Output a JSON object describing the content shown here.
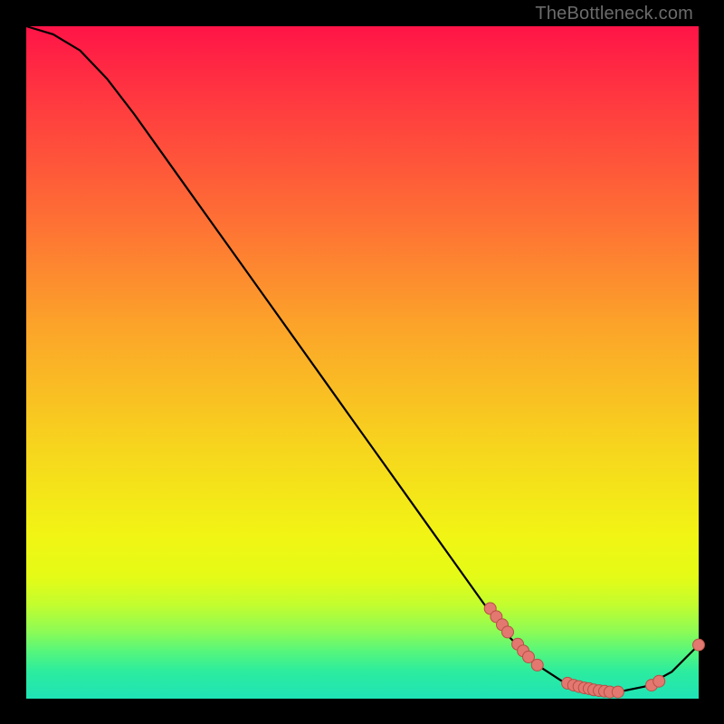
{
  "watermark": "TheBottleneck.com",
  "colors": {
    "line": "#000000",
    "line_width": 2.2,
    "marker_fill": "#e27870",
    "marker_stroke": "#b84f47",
    "marker_radius": 6.5
  },
  "chart_data": {
    "type": "line",
    "title": "",
    "xlabel": "",
    "ylabel": "",
    "xlim": [
      0,
      100
    ],
    "ylim": [
      0,
      100
    ],
    "line_xy": [
      [
        0,
        100
      ],
      [
        4,
        98.8
      ],
      [
        8,
        96.4
      ],
      [
        12,
        92.2
      ],
      [
        16,
        87.0
      ],
      [
        20,
        81.4
      ],
      [
        24,
        75.8
      ],
      [
        28,
        70.2
      ],
      [
        32,
        64.6
      ],
      [
        36,
        59.0
      ],
      [
        40,
        53.4
      ],
      [
        44,
        47.8
      ],
      [
        48,
        42.2
      ],
      [
        52,
        36.6
      ],
      [
        56,
        31.0
      ],
      [
        60,
        25.4
      ],
      [
        64,
        19.8
      ],
      [
        68,
        14.2
      ],
      [
        72,
        9.0
      ],
      [
        76,
        5.0
      ],
      [
        80,
        2.4
      ],
      [
        84,
        1.2
      ],
      [
        88,
        1.0
      ],
      [
        92,
        1.8
      ],
      [
        96,
        4.0
      ],
      [
        100,
        8.0
      ]
    ],
    "markers_xy": [
      [
        69.0,
        13.4
      ],
      [
        69.9,
        12.2
      ],
      [
        70.8,
        11.0
      ],
      [
        71.6,
        9.9
      ],
      [
        73.1,
        8.1
      ],
      [
        73.9,
        7.1
      ],
      [
        74.7,
        6.2
      ],
      [
        76.0,
        5.0
      ],
      [
        80.5,
        2.3
      ],
      [
        81.4,
        2.0
      ],
      [
        82.2,
        1.8
      ],
      [
        83.0,
        1.6
      ],
      [
        83.7,
        1.5
      ],
      [
        84.4,
        1.3
      ],
      [
        85.2,
        1.2
      ],
      [
        86.0,
        1.1
      ],
      [
        86.8,
        1.0
      ],
      [
        88.0,
        1.0
      ],
      [
        93.0,
        2.0
      ],
      [
        94.1,
        2.6
      ],
      [
        100.0,
        8.0
      ]
    ]
  }
}
